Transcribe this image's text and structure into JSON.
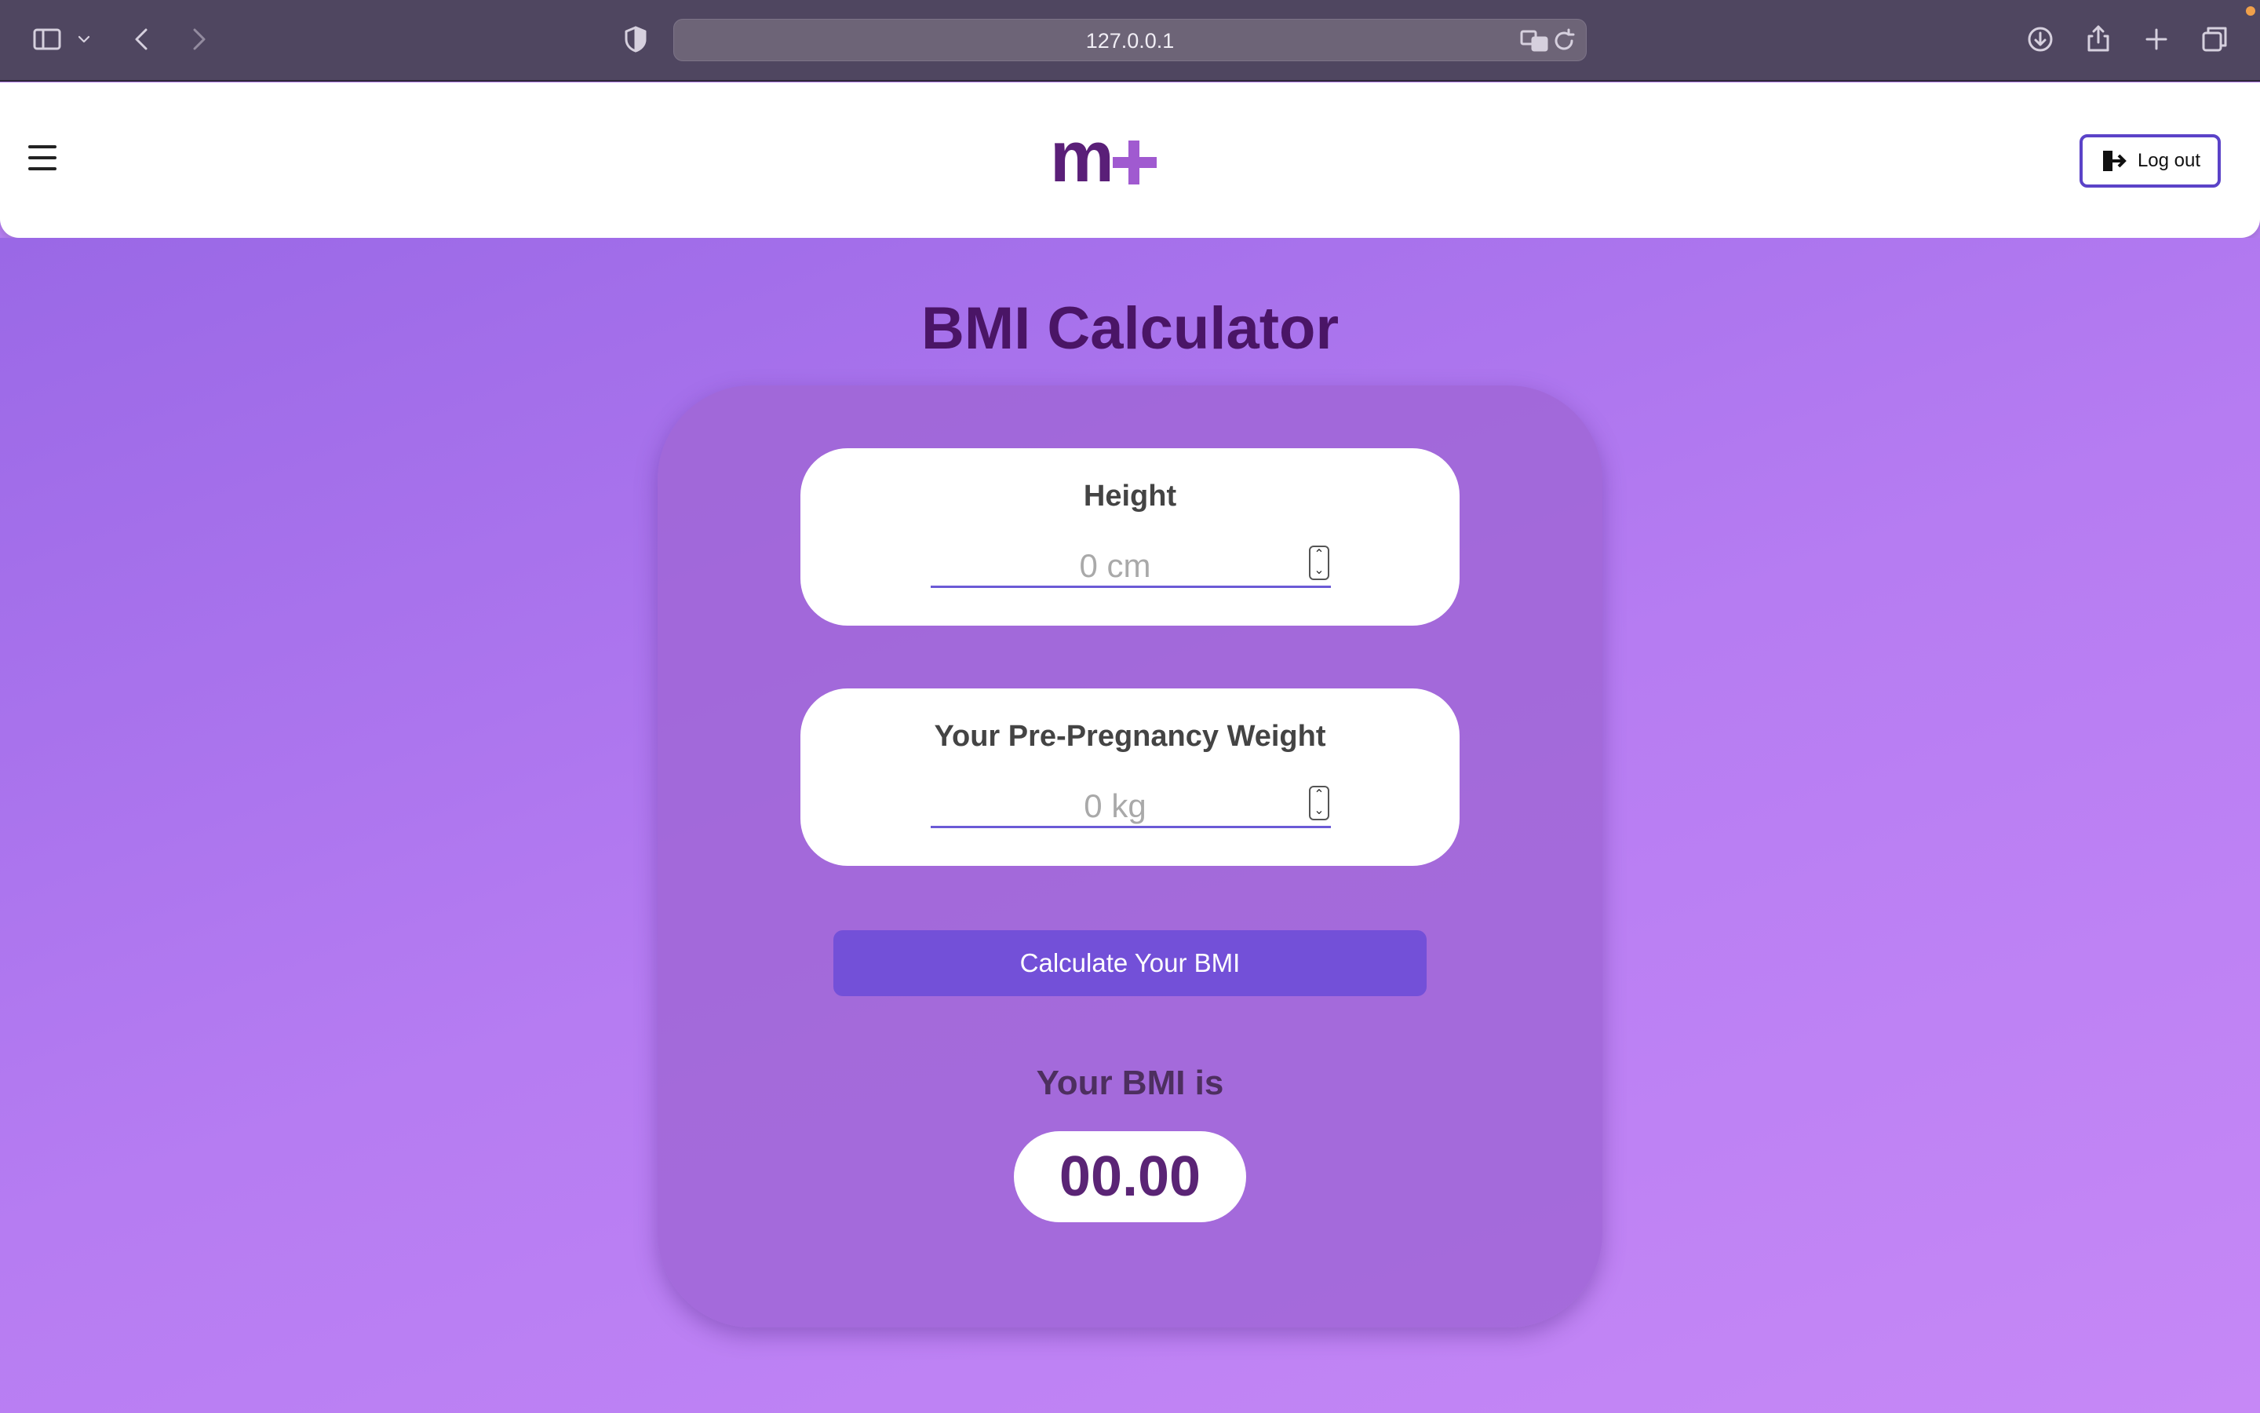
{
  "browser": {
    "url": "127.0.0.1",
    "icons": [
      "sidebar-icon",
      "chevron-down-icon",
      "back-icon",
      "forward-icon",
      "shield-icon",
      "translate-icon",
      "reload-icon",
      "download-icon",
      "share-icon",
      "new-tab-icon",
      "tabs-overview-icon"
    ]
  },
  "header": {
    "logo": "m+",
    "logout_label": "Log out",
    "brand_colors": {
      "dark": "#5a1f78",
      "light": "#a05ad0"
    }
  },
  "page": {
    "title": "BMI Calculator",
    "height": {
      "label": "Height",
      "placeholder": "0 cm",
      "value": ""
    },
    "weight": {
      "label": "Your Pre-Pregnancy Weight",
      "placeholder": "0 kg",
      "value": ""
    },
    "calculate_label": "Calculate Your BMI",
    "result_label": "Your BMI is",
    "result_value": "00.00"
  },
  "colors": {
    "accent": "#7350d8",
    "title": "#4a1566",
    "outline": "#5b43c8"
  }
}
